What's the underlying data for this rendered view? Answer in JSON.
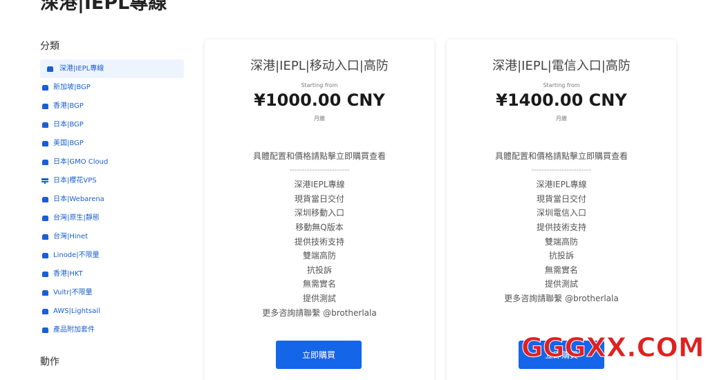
{
  "page": {
    "title": "深港|IEPL專線"
  },
  "sidebar": {
    "heading": "分類",
    "items": [
      {
        "label": "深港|IEPL專線",
        "icon": "box-icon",
        "active": true
      },
      {
        "label": "新加坡|BGP",
        "icon": "box-icon"
      },
      {
        "label": "香港|BGP",
        "icon": "box-icon"
      },
      {
        "label": "日本|BGP",
        "icon": "box-icon"
      },
      {
        "label": "美国|BGP",
        "icon": "box-icon"
      },
      {
        "label": "日本|GMO Cloud",
        "icon": "box-icon"
      },
      {
        "label": "日本|櫻花VPS",
        "icon": "server-icon"
      },
      {
        "label": "日本|Webarena",
        "icon": "box-icon"
      },
      {
        "label": "台灣|原生|靜態",
        "icon": "box-icon"
      },
      {
        "label": "台灣|Hinet",
        "icon": "box-icon"
      },
      {
        "label": "Linode|不限量",
        "icon": "box-icon"
      },
      {
        "label": "香港|HKT",
        "icon": "box-icon"
      },
      {
        "label": "Vultr|不限量",
        "icon": "box-icon"
      },
      {
        "label": "AWS|Lightsail",
        "icon": "box-icon"
      },
      {
        "label": "產品附加套件",
        "icon": "box-icon"
      }
    ],
    "heading_2": "動作"
  },
  "products": [
    {
      "title": "深港|IEPL|移动入口|高防",
      "starting_from": "Starting from",
      "price": "¥1000.00 CNY",
      "cycle": "月繳",
      "description": [
        "具體配置和價格請點擊立即購買查看",
        "------------------------",
        "深港IEPL專線",
        "現貨當日交付",
        "深圳移動入口",
        "移動無Q版本",
        "提供技術支持",
        "雙端高防",
        "抗投訴",
        "無需實名",
        "提供測試",
        "更多咨詢請聯繫 @brotherlala"
      ],
      "button_label": "立即購買"
    },
    {
      "title": "深港|IEPL|電信入口|高防",
      "starting_from": "Starting from",
      "price": "¥1400.00 CNY",
      "cycle": "月繳",
      "description": [
        "具體配置和價格請點擊立即購買查看",
        "------------------------",
        "深港IEPL專線",
        "現貨當日交付",
        "深圳電信入口",
        "提供技術支持",
        "雙端高防",
        "抗投訴",
        "無需實名",
        "提供測試",
        "更多咨詢請聯繫 @brotherlala"
      ],
      "button_label": "立即購買"
    }
  ],
  "watermark": {
    "text": "GGGXX.COM",
    "color": "#e02020"
  },
  "colors": {
    "accent": "#1565e9",
    "link": "#1a5fd1",
    "active_bg": "#eef4fe"
  }
}
